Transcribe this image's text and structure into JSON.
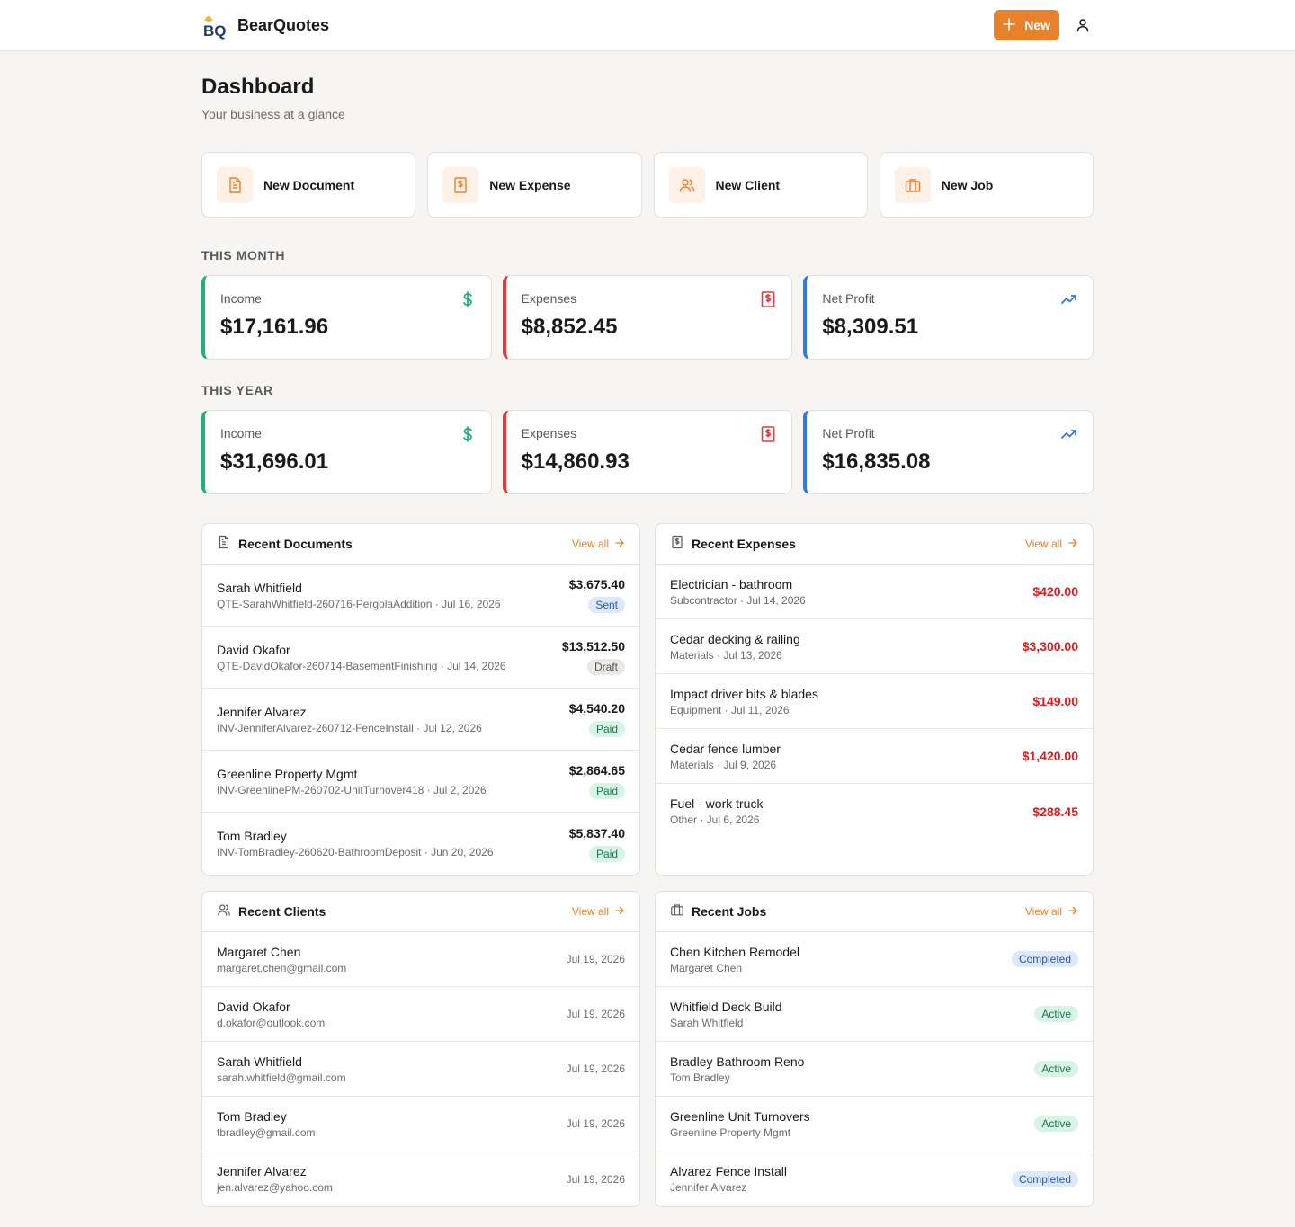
{
  "app": {
    "name": "BearQuotes",
    "new_label": "New"
  },
  "page": {
    "title": "Dashboard",
    "subtitle": "Your business at a glance"
  },
  "quick_actions": [
    {
      "label": "New Document",
      "icon": "document-icon"
    },
    {
      "label": "New Expense",
      "icon": "receipt-icon"
    },
    {
      "label": "New Client",
      "icon": "users-icon"
    },
    {
      "label": "New Job",
      "icon": "briefcase-icon"
    }
  ],
  "this_month": {
    "label": "THIS MONTH",
    "income": {
      "label": "Income",
      "value": "$17,161.96"
    },
    "expenses": {
      "label": "Expenses",
      "value": "$8,852.45"
    },
    "profit": {
      "label": "Net Profit",
      "value": "$8,309.51"
    }
  },
  "this_year": {
    "label": "THIS YEAR",
    "income": {
      "label": "Income",
      "value": "$31,696.01"
    },
    "expenses": {
      "label": "Expenses",
      "value": "$14,860.93"
    },
    "profit": {
      "label": "Net Profit",
      "value": "$16,835.08"
    }
  },
  "colors": {
    "accent": "#e8822a",
    "income": "#1fb37a",
    "expense": "#e23a3a",
    "profit": "#2e7be5"
  },
  "recent_documents": {
    "title": "Recent Documents",
    "view_all": "View all",
    "items": [
      {
        "name": "Sarah Whitfield",
        "meta": "QTE-SarahWhitfield-260716-PergolaAddition · Jul 16, 2026",
        "amount": "$3,675.40",
        "status": "Sent",
        "status_key": "sent"
      },
      {
        "name": "David Okafor",
        "meta": "QTE-DavidOkafor-260714-BasementFinishing · Jul 14, 2026",
        "amount": "$13,512.50",
        "status": "Draft",
        "status_key": "draft"
      },
      {
        "name": "Jennifer Alvarez",
        "meta": "INV-JenniferAlvarez-260712-FenceInstall · Jul 12, 2026",
        "amount": "$4,540.20",
        "status": "Paid",
        "status_key": "paid"
      },
      {
        "name": "Greenline Property Mgmt",
        "meta": "INV-GreenlinePM-260702-UnitTurnover418 · Jul 2, 2026",
        "amount": "$2,864.65",
        "status": "Paid",
        "status_key": "paid"
      },
      {
        "name": "Tom Bradley",
        "meta": "INV-TomBradley-260620-BathroomDeposit · Jun 20, 2026",
        "amount": "$5,837.40",
        "status": "Paid",
        "status_key": "paid"
      }
    ]
  },
  "recent_expenses": {
    "title": "Recent Expenses",
    "view_all": "View all",
    "items": [
      {
        "name": "Electrician - bathroom",
        "meta": "Subcontractor · Jul 14, 2026",
        "amount": "$420.00"
      },
      {
        "name": "Cedar decking & railing",
        "meta": "Materials · Jul 13, 2026",
        "amount": "$3,300.00"
      },
      {
        "name": "Impact driver bits & blades",
        "meta": "Equipment · Jul 11, 2026",
        "amount": "$149.00"
      },
      {
        "name": "Cedar fence lumber",
        "meta": "Materials · Jul 9, 2026",
        "amount": "$1,420.00"
      },
      {
        "name": "Fuel - work truck",
        "meta": "Other · Jul 6, 2026",
        "amount": "$288.45"
      }
    ]
  },
  "recent_clients": {
    "title": "Recent Clients",
    "view_all": "View all",
    "items": [
      {
        "name": "Margaret Chen",
        "email": "margaret.chen@gmail.com",
        "date": "Jul 19, 2026"
      },
      {
        "name": "David Okafor",
        "email": "d.okafor@outlook.com",
        "date": "Jul 19, 2026"
      },
      {
        "name": "Sarah Whitfield",
        "email": "sarah.whitfield@gmail.com",
        "date": "Jul 19, 2026"
      },
      {
        "name": "Tom Bradley",
        "email": "tbradley@gmail.com",
        "date": "Jul 19, 2026"
      },
      {
        "name": "Jennifer Alvarez",
        "email": "jen.alvarez@yahoo.com",
        "date": "Jul 19, 2026"
      }
    ]
  },
  "recent_jobs": {
    "title": "Recent Jobs",
    "view_all": "View all",
    "items": [
      {
        "name": "Chen Kitchen Remodel",
        "client": "Margaret Chen",
        "status": "Completed",
        "status_key": "completed"
      },
      {
        "name": "Whitfield Deck Build",
        "client": "Sarah Whitfield",
        "status": "Active",
        "status_key": "active"
      },
      {
        "name": "Bradley Bathroom Reno",
        "client": "Tom Bradley",
        "status": "Active",
        "status_key": "active"
      },
      {
        "name": "Greenline Unit Turnovers",
        "client": "Greenline Property Mgmt",
        "status": "Active",
        "status_key": "active"
      },
      {
        "name": "Alvarez Fence Install",
        "client": "Jennifer Alvarez",
        "status": "Completed",
        "status_key": "completed"
      }
    ]
  }
}
